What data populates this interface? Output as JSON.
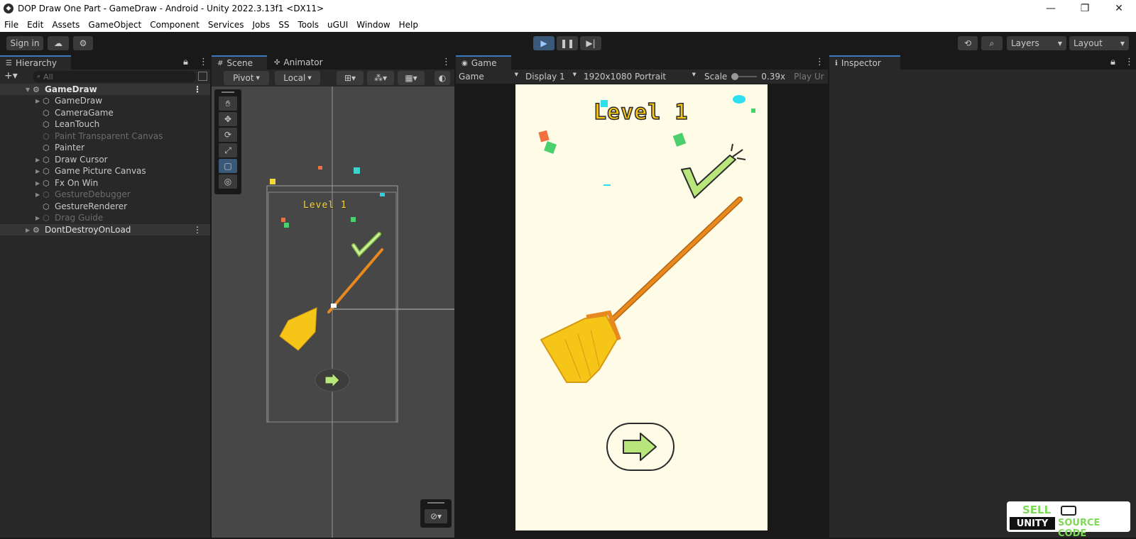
{
  "window": {
    "title": "DOP Draw One Part - GameDraw - Android - Unity 2022.3.13f1 <DX11>",
    "controls": [
      "—",
      "❐",
      "✕"
    ]
  },
  "menu": [
    "File",
    "Edit",
    "Assets",
    "GameObject",
    "Component",
    "Services",
    "Jobs",
    "SS",
    "Tools",
    "uGUI",
    "Window",
    "Help"
  ],
  "toolbar": {
    "sign_in": "Sign in",
    "layers": "Layers",
    "layout": "Layout"
  },
  "hierarchy": {
    "tab": "Hierarchy",
    "search_placeholder": "All",
    "items": [
      {
        "label": "GameDraw",
        "type": "scene"
      },
      {
        "label": "GameDraw",
        "type": "child-expandable"
      },
      {
        "label": "CameraGame",
        "type": "child"
      },
      {
        "label": "LeanTouch",
        "type": "child"
      },
      {
        "label": "Paint Transparent Canvas",
        "type": "disabled"
      },
      {
        "label": "Painter",
        "type": "child"
      },
      {
        "label": "Draw Cursor",
        "type": "child-expandable"
      },
      {
        "label": "Game Picture Canvas",
        "type": "child-expandable"
      },
      {
        "label": "Fx On Win",
        "type": "child-expandable"
      },
      {
        "label": "GestureDebugger",
        "type": "disabled-expandable"
      },
      {
        "label": "GestureRenderer",
        "type": "child"
      },
      {
        "label": "Drag Guide",
        "type": "disabled-expandable"
      },
      {
        "label": "DontDestroyOnLoad",
        "type": "scene"
      }
    ]
  },
  "scene": {
    "tabs": [
      "Scene",
      "Animator"
    ],
    "pivot": "Pivot",
    "local": "Local",
    "level_text": "Level 1"
  },
  "game": {
    "tab": "Game",
    "mode": "Game",
    "display": "Display 1",
    "resolution": "1920x1080 Portrait",
    "scale_label": "Scale",
    "scale_value": "0.39x",
    "play_unfocused": "Play Ur",
    "level_text": "Level 1"
  },
  "inspector": {
    "tab": "Inspector"
  },
  "watermark": {
    "line1": "SELL",
    "line2": "UNITY",
    "line3": "SOURCE CODE"
  },
  "colors": {
    "accent": "#3a79bb",
    "game_bg": "#fefce6",
    "broom_yellow": "#f5c518",
    "handle_orange": "#e8891f",
    "check_green": "#b8e67a"
  }
}
